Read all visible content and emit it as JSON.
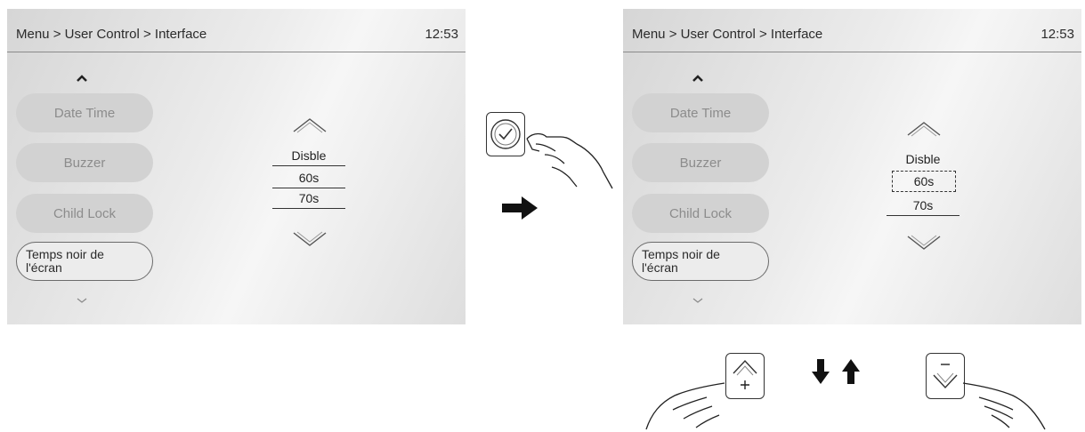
{
  "screens": [
    {
      "breadcrumb": "Menu > User Control > Interface",
      "time": "12:53",
      "menu_items": [
        "Date Time",
        "Buzzer",
        "Child Lock",
        "Temps noir de\nl'écran"
      ],
      "options": [
        "Disble",
        "60s",
        "70s"
      ],
      "highlighted_option": 1
    },
    {
      "breadcrumb": "Menu > User Control > Interface",
      "time": "12:53",
      "menu_items": [
        "Date Time",
        "Buzzer",
        "Child Lock",
        "Temps noir de\nl'écran"
      ],
      "options": [
        "Disble",
        "60s",
        "70s"
      ],
      "highlighted_option": 1
    }
  ],
  "icons": {
    "confirm": "check-circle-icon",
    "next_step": "arrow-right-icon",
    "up_button": "up-plus-icon",
    "down_button": "down-minus-icon",
    "cycle": "down-up-arrows-icon"
  }
}
